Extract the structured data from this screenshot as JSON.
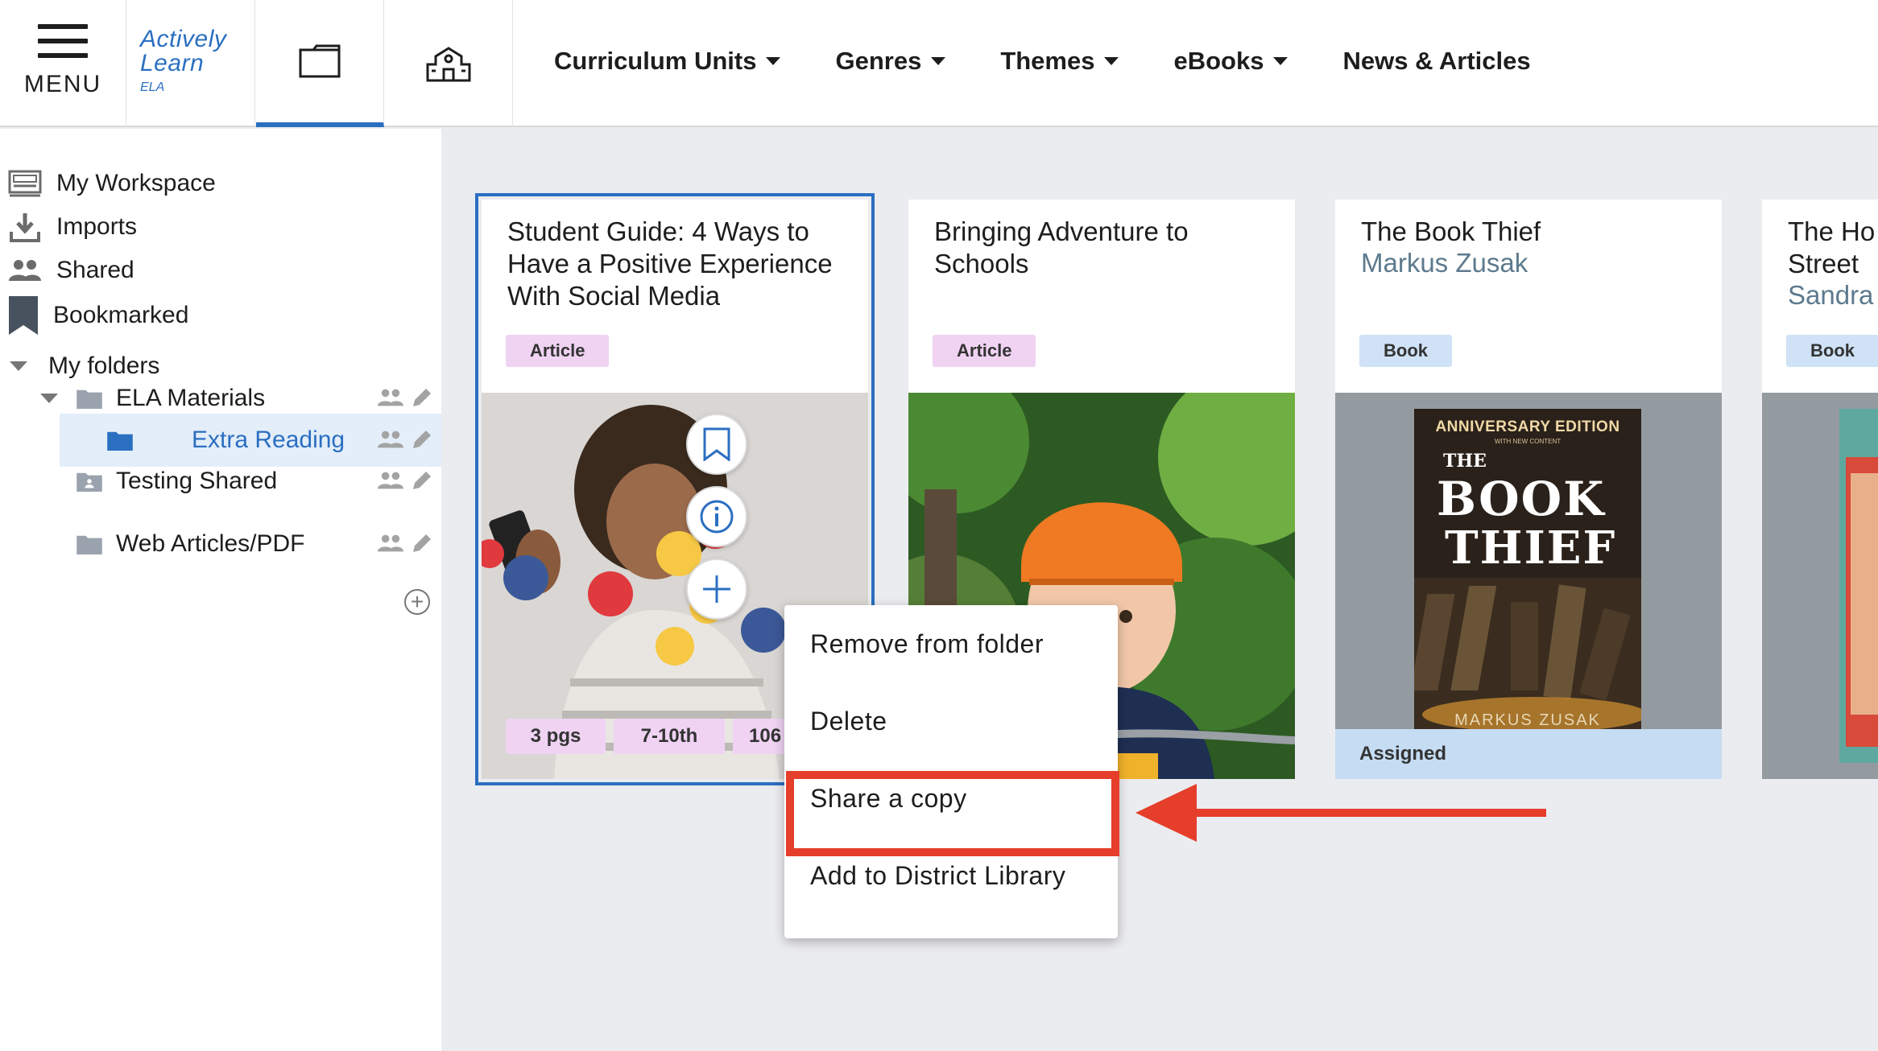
{
  "header": {
    "menu_label": "MENU",
    "logo_line1": "Actively",
    "logo_line2": "Learn",
    "logo_sub": "ELA",
    "nav": [
      {
        "label": "Curriculum Units",
        "dropdown": true
      },
      {
        "label": "Genres",
        "dropdown": true
      },
      {
        "label": "Themes",
        "dropdown": true
      },
      {
        "label": "eBooks",
        "dropdown": true
      },
      {
        "label": "News & Articles",
        "dropdown": false
      }
    ],
    "active_tab": "folder-icon"
  },
  "sidebar": {
    "items": [
      {
        "label": "My Workspace",
        "icon": "workspace-icon"
      },
      {
        "label": "Imports",
        "icon": "download-icon"
      },
      {
        "label": "Shared",
        "icon": "people-icon"
      },
      {
        "label": "Bookmarked",
        "icon": "bookmark-icon"
      }
    ],
    "folders_header": "My folders",
    "folders": [
      {
        "label": "ELA Materials",
        "expanded": true
      },
      {
        "label": "Extra Reading",
        "active": true
      },
      {
        "label": "Testing Shared"
      },
      {
        "label": "Web Articles/PDF"
      }
    ]
  },
  "cards": [
    {
      "title": "Student Guide: 4 Ways to Have a Positive Experience With Social Media",
      "author": "",
      "badge": "Article",
      "meta": [
        "3 pgs",
        "7-10th",
        "106"
      ]
    },
    {
      "title": "Bringing Adventure to Schools",
      "author": "",
      "badge": "Article"
    },
    {
      "title": "The Book Thief",
      "author": "Markus Zusak",
      "badge": "Book",
      "status": "Assigned",
      "cover": {
        "edition": "ANNIVERSARY EDITION",
        "edition_sub": "WITH NEW CONTENT",
        "the": "THE",
        "word1": "BOOK",
        "word2": "THIEF",
        "author": "MARKUS ZUSAK"
      }
    },
    {
      "title": "The Ho",
      "title2": "Street",
      "author": "Sandra",
      "badge": "Book"
    }
  ],
  "context_menu": {
    "items": [
      "Remove from folder",
      "Delete",
      "Share a copy",
      "Add to District Library"
    ],
    "highlighted": "Share a copy"
  },
  "colors": {
    "accent": "#2b6fc1",
    "annotation": "#e53e2b",
    "article_badge": "#f0d3f3",
    "book_badge": "#cfe2f6"
  }
}
